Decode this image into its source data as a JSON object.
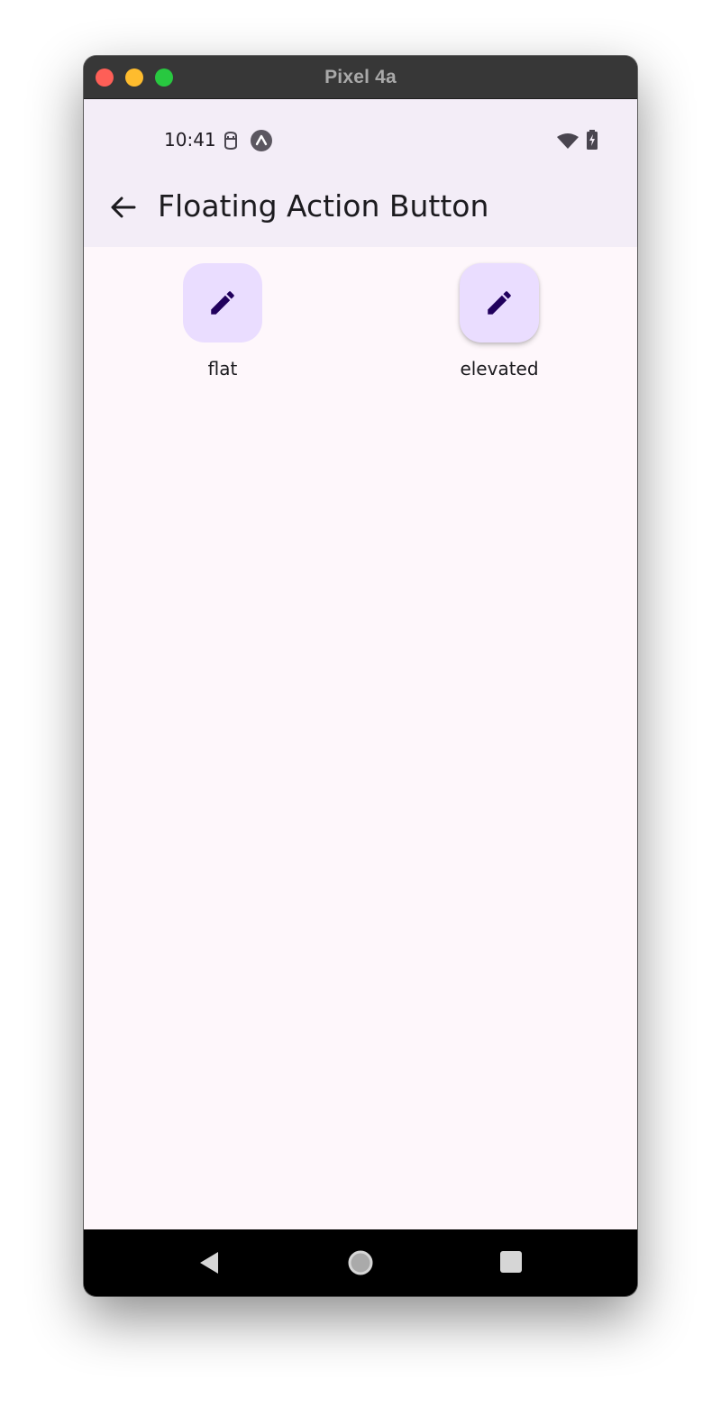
{
  "window": {
    "title": "Pixel 4a"
  },
  "status_bar": {
    "time": "10:41",
    "icons": [
      "sim-card-icon",
      "app-notification-icon",
      "wifi-icon",
      "battery-charging-icon"
    ]
  },
  "app_bar": {
    "title": "Floating Action Button",
    "back_icon": "arrow-back-icon"
  },
  "fabs": [
    {
      "label": "flat",
      "icon": "edit-pencil-icon"
    },
    {
      "label": "elevated",
      "icon": "edit-pencil-icon"
    }
  ],
  "nav_bar": {
    "buttons": [
      "back-triangle-icon",
      "home-circle-icon",
      "recents-square-icon"
    ]
  },
  "colors": {
    "app_bar_bg": "#f3edf7",
    "screen_bg": "#fef7fb",
    "fab_bg": "#eaddff",
    "fab_icon": "#21005d"
  }
}
